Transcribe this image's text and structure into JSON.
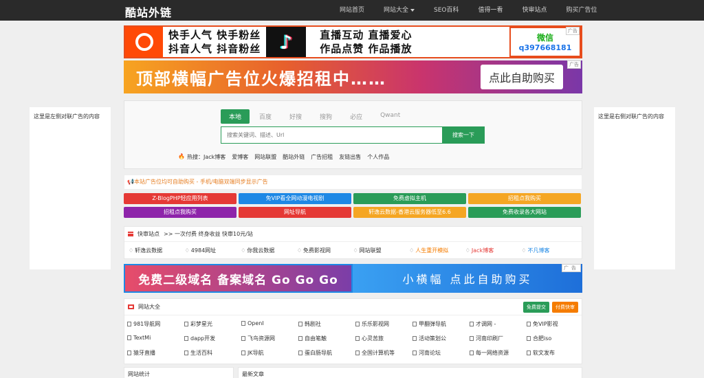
{
  "header": {
    "logo": "酷站外链",
    "nav": [
      {
        "label": "网站首页"
      },
      {
        "label": "网站大全"
      },
      {
        "label": "SEO百科"
      },
      {
        "label": "值得一看"
      },
      {
        "label": "快审站点"
      },
      {
        "label": "购买广告位"
      }
    ]
  },
  "ad_top": {
    "tag": "广告",
    "line1": "快手人气  快手粉丝",
    "line2": "抖音人气  抖音粉丝",
    "line3": "直播互动  直播爱心",
    "line4": "作品点赞  作品播放",
    "wechat_title": "微信",
    "wechat_id": "q397668181"
  },
  "ad_banner": {
    "tag": "广告",
    "text": "顶部横幅广告位火爆招租中……",
    "button": "点此自助购买"
  },
  "side_ads": {
    "left": "这里是左侧对联广告的内容",
    "right": "这里是右侧对联广告的内容"
  },
  "search": {
    "tabs": [
      "本地",
      "百度",
      "好搜",
      "搜狗",
      "必应",
      "Qwant"
    ],
    "placeholder": "搜索关键词、描述、Url",
    "button": "搜索一下",
    "hot_label": "热搜：",
    "hot": [
      "Jack博客",
      "爱博客",
      "网站联盟",
      "酷站外链",
      "广告招租",
      "友链出售",
      "个人作品"
    ]
  },
  "notice": "本站广告位均可自助购买 - 手机/电脑双端同步显示广告",
  "color_links": [
    {
      "label": "Z-BlogPHP轻应用列表",
      "color": "#e53935"
    },
    {
      "label": "免VIP看全网动漫电视剧",
      "color": "#1e88e5"
    },
    {
      "label": "免费虚拟主机",
      "color": "#2a9c58"
    },
    {
      "label": "招租点我购买",
      "color": "#f5a623"
    },
    {
      "label": "招租点我购买",
      "color": "#8e24aa"
    },
    {
      "label": "网址导航",
      "color": "#e53935"
    },
    {
      "label": "轩逸云数据-香港云服务器低至6.6",
      "color": "#f5a623"
    },
    {
      "label": "免费收录各大网站",
      "color": "#2a9c58"
    }
  ],
  "quick_review": {
    "title": "快审站点",
    "subtitle": ">> 一次付费 终身收益 快审10元/站",
    "items": [
      {
        "label": "轩逸云数据",
        "color": "#333333"
      },
      {
        "label": "4984网址",
        "color": "#333333"
      },
      {
        "label": "你我云数据",
        "color": "#333333"
      },
      {
        "label": "免费影视网",
        "color": "#333333"
      },
      {
        "label": "网站联盟",
        "color": "#333333"
      },
      {
        "label": "人生重开模拟",
        "color": "#f57c00"
      },
      {
        "label": "Jack博客",
        "color": "#e53935"
      },
      {
        "label": "不凡博客",
        "color": "#1e88e5"
      }
    ]
  },
  "ad_bottom": {
    "left": "免费二级域名 备案域名 Go Go Go",
    "right": "小横幅 点此自助购买",
    "tag": "广告"
  },
  "directory": {
    "title": "网站大全",
    "submit": "免费提交",
    "paid": "付费快审",
    "sites": [
      "981导航网",
      "彩梦星光",
      "OpenI",
      "韩剧社",
      "乐乐影视网",
      "甲翻弹导航",
      "才调网 -",
      "免VIP影视",
      "TextMi",
      "dapp开发",
      "飞鸟资源网",
      "自由笔触",
      "心灵苦旅",
      "活动策划公",
      "河南印刷厂",
      "合肥iso",
      "猿牙直播",
      "生活百科",
      "JK导航",
      "蛋白肠导航",
      "全国计算机等",
      "河南论坛",
      "每一网络资源",
      "软文发布"
    ]
  },
  "bottom": {
    "left": "网站统计",
    "right": "最新文章"
  }
}
